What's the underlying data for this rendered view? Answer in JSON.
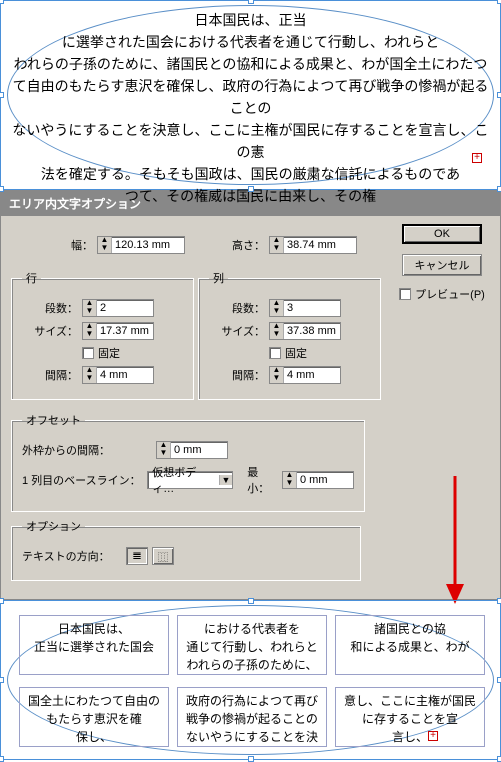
{
  "topText": "日本国民は、正当\nに選挙された国会における代表者を通じて行動し、われらと\nわれらの子孫のために、諸国民との協和による成果と、わが国全土にわたつ\nて自由のもたらす恵沢を確保し、政府の行為によつて再び戦争の惨禍が起ることの\nないやうにすることを決意し、ここに主権が国民に存することを宣言し、この憲\n法を確定する。そもそも国政は、国民の厳粛な信託によるものであ\nつて、その権威は国民に由来し、その権",
  "dialog": {
    "title": "エリア内文字オプション",
    "width_label": "幅：",
    "width_value": "120.13 mm",
    "height_label": "高さ：",
    "height_value": "38.74 mm",
    "ok": "OK",
    "cancel": "キャンセル",
    "preview": "プレビュー(P)",
    "rows": {
      "legend": "行",
      "count_label": "段数：",
      "count_value": "2",
      "size_label": "サイズ：",
      "size_value": "17.37 mm",
      "fixed": "固定",
      "gutter_label": "間隔：",
      "gutter_value": "4 mm"
    },
    "cols": {
      "legend": "列",
      "count_label": "段数：",
      "count_value": "3",
      "size_label": "サイズ：",
      "size_value": "37.38 mm",
      "fixed": "固定",
      "gutter_label": "間隔：",
      "gutter_value": "4 mm"
    },
    "offset": {
      "legend": "オフセット",
      "inset_label": "外枠からの間隔：",
      "inset_value": "0 mm",
      "baseline_label": "1 列目のベースライン：",
      "baseline_value": "仮想ボディ…",
      "min_label": "最小：",
      "min_value": "0 mm"
    },
    "options": {
      "legend": "オプション",
      "flow_label": "テキストの方向："
    }
  },
  "cells": [
    [
      "日本国民は、\n正当に選挙された国会",
      "における代表者を\n通じて行動し、われらと\nわれらの子孫のために、",
      "諸国民との協\n和による成果と、わが"
    ],
    [
      "国全土にわたつて自由の\nもたらす恵沢を確\n保し、",
      "政府の行為によつて再び\n戦争の惨禍が起ることの\nないやうにすることを決",
      "意し、ここに主権が国民\nに存することを宣\n言し、"
    ]
  ]
}
